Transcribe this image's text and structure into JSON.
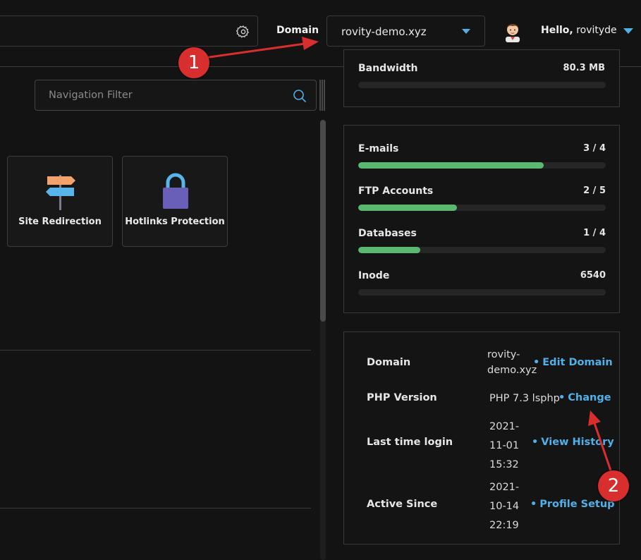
{
  "header": {
    "domain_label": "Domain",
    "domain_selected": "rovity-demo.xyz",
    "greeting_prefix": "Hello,",
    "username": "rovityde"
  },
  "nav": {
    "filter_placeholder": "Navigation Filter",
    "tiles": [
      {
        "label": "Site Redirection",
        "icon": "signpost-icon"
      },
      {
        "label": "Hotlinks Protection",
        "icon": "padlock-icon"
      }
    ]
  },
  "usage": {
    "bandwidth": {
      "label": "Bandwidth",
      "value": "80.3 MB"
    },
    "stats": [
      {
        "label": "E-mails",
        "value": "3 / 4",
        "fraction": 0.75
      },
      {
        "label": "FTP Accounts",
        "value": "2 / 5",
        "fraction": 0.4
      },
      {
        "label": "Databases",
        "value": "1 / 4",
        "fraction": 0.25
      },
      {
        "label": "Inode",
        "value": "6540",
        "fraction": 0
      }
    ]
  },
  "account_info": {
    "rows": [
      {
        "label": "Domain",
        "value_lines": [
          "rovity-",
          "demo.xyz"
        ],
        "link": "Edit Domain"
      },
      {
        "label": "PHP Version",
        "value_lines": [
          "PHP 7.3 lsphp"
        ],
        "link": "Change"
      },
      {
        "label": "Last time login",
        "value_lines": [
          "2021-",
          "11-01",
          "15:32"
        ],
        "link": "View History"
      },
      {
        "label": "Active Since",
        "value_lines": [
          "2021-",
          "10-14",
          "22:19"
        ],
        "link": "Profile Setup"
      }
    ]
  },
  "annotations": {
    "badge_1": "1",
    "badge_2": "2",
    "color": "#d92e2e"
  },
  "colors": {
    "accent": "#4fb1ea",
    "progress": "#5ab86f",
    "background": "#131313"
  }
}
